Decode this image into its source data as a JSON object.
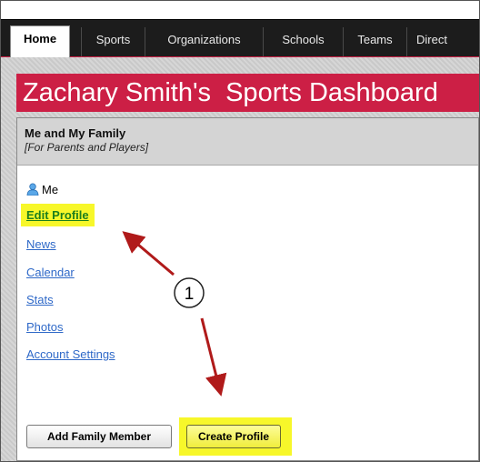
{
  "nav": {
    "tabs": [
      {
        "label": "Home",
        "active": true
      },
      {
        "label": "Sports"
      },
      {
        "label": "Organizations"
      },
      {
        "label": "Schools"
      },
      {
        "label": "Teams"
      },
      {
        "label": "Direct"
      }
    ]
  },
  "banner": {
    "title": "Zachary Smith's  Sports Dashboard"
  },
  "panel": {
    "title": "Me and My Family",
    "subtitle": "[For Parents and Players]",
    "me_label": "Me",
    "links": [
      {
        "label": "Edit Profile",
        "highlighted": true
      },
      {
        "label": "News"
      },
      {
        "label": "Calendar"
      },
      {
        "label": "Stats"
      },
      {
        "label": "Photos"
      },
      {
        "label": "Account Settings"
      }
    ],
    "buttons": {
      "add_family": "Add Family Member",
      "create_profile": "Create Profile"
    }
  },
  "annotation": {
    "callout_number": "1"
  },
  "colors": {
    "brand_red": "#cc1f45",
    "highlight_yellow": "#f7f72a",
    "link_blue": "#2f69c8",
    "arrow_red": "#b01a1a"
  }
}
